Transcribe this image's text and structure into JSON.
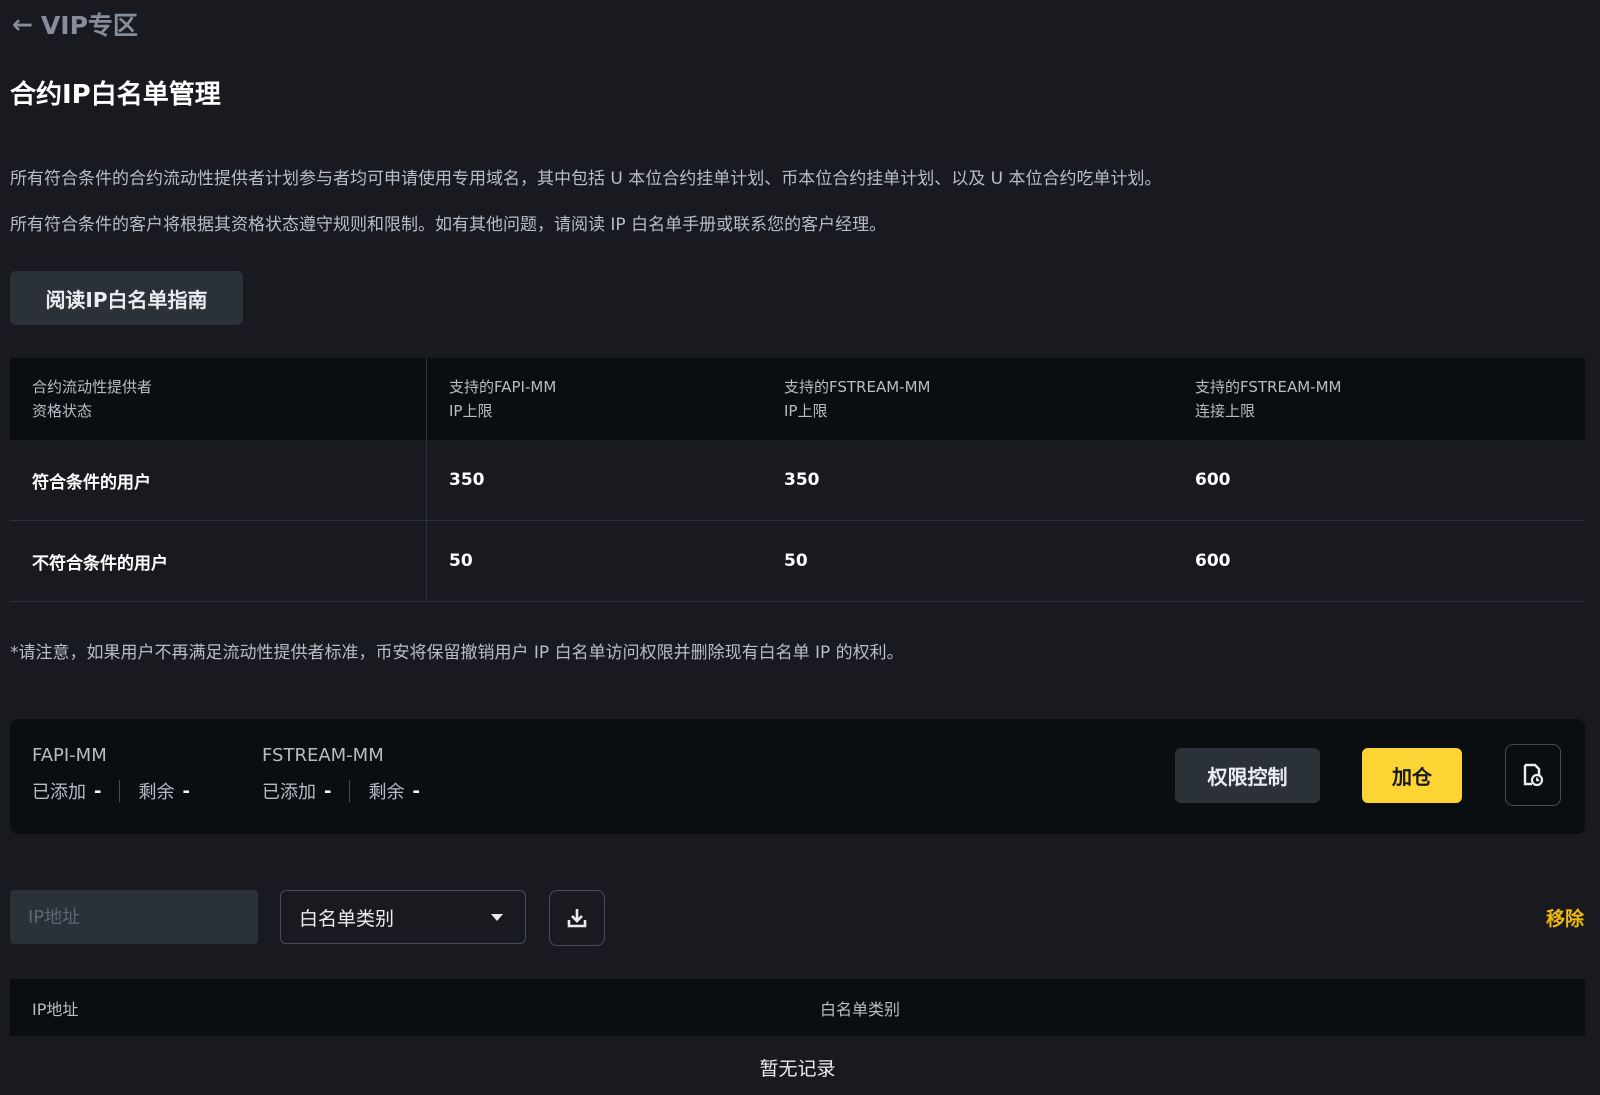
{
  "nav": {
    "back_icon": "arrow-left-icon",
    "back_label": "VIP专区"
  },
  "page": {
    "title": "合约IP白名单管理",
    "description_1": "所有符合条件的合约流动性提供者计划参与者均可申请使用专用域名，其中包括 U 本位合约挂单计划、币本位合约挂单计划、以及 U 本位合约吃单计划。",
    "description_2": "所有符合条件的客户将根据其资格状态遵守规则和限制。如有其他问题，请阅读 IP 白名单手册或联系您的客户经理。",
    "guide_button": "阅读IP白名单指南",
    "note": "*请注意，如果用户不再满足流动性提供者标准，币安将保留撤销用户 IP 白名单访问权限并删除现有白名单 IP 的权利。"
  },
  "tier_table": {
    "headers": [
      [
        "合约流动性提供者",
        "资格状态"
      ],
      [
        "支持的FAPI-MM",
        "IP上限"
      ],
      [
        "支持的FSTREAM-MM",
        "IP上限"
      ],
      [
        "支持的FSTREAM-MM",
        "连接上限"
      ]
    ],
    "rows": [
      [
        "符合条件的用户",
        "350",
        "350",
        "600"
      ],
      [
        "不符合条件的用户",
        "50",
        "50",
        "600"
      ]
    ]
  },
  "quota_panel": {
    "fapi": {
      "name": "FAPI-MM",
      "added_label": "已添加",
      "added_value": "-",
      "remaining_label": "剩余",
      "remaining_value": "-"
    },
    "fstream": {
      "name": "FSTREAM-MM",
      "added_label": "已添加",
      "added_value": "-",
      "remaining_label": "剩余",
      "remaining_value": "-"
    },
    "permission_button": "权限控制",
    "add_button": "加仓",
    "history_icon": "history-file-icon"
  },
  "filters": {
    "ip_placeholder": "IP地址",
    "type_select_value": "白名单类别",
    "download_icon": "download-icon",
    "remove_label": "移除"
  },
  "list": {
    "headers": [
      "IP地址",
      "白名单类别"
    ],
    "empty_text": "暂无记录"
  },
  "colors": {
    "background": "#181a20",
    "panel": "#0b0e11",
    "accent_yellow": "#fcd535",
    "link_yellow": "#f0b90b"
  }
}
